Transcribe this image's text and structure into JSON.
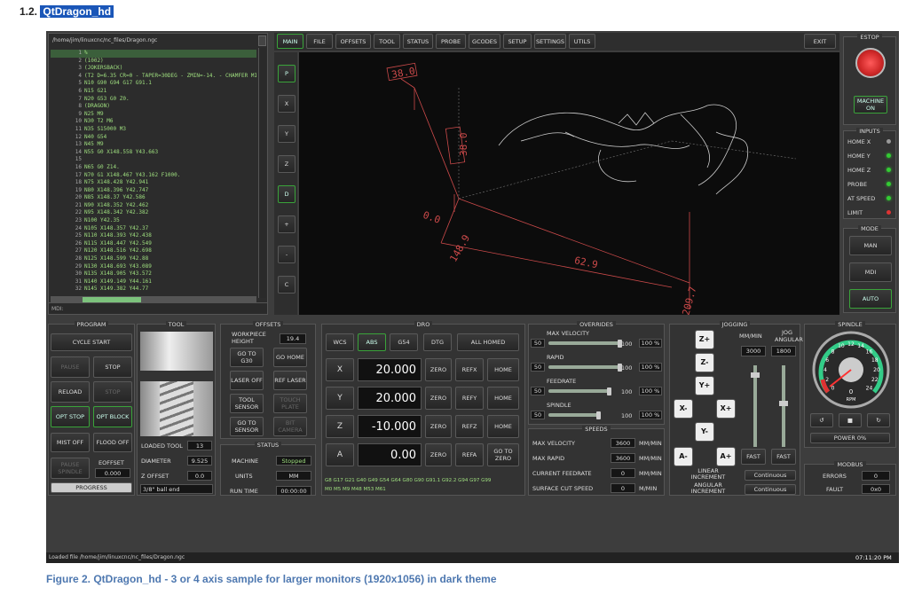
{
  "section": {
    "num": "1.2.",
    "title": "QtDragon_hd"
  },
  "caption": "Figure 2. QtDragon_hd - 3 or 4 axis sample for larger monitors (1920x1056) in dark theme",
  "file_path": "/home/jim/linuxcnc/nc_files/Dragon.ngc",
  "mdi_label": "MDI:",
  "gcode": [
    {
      "n": "1",
      "t": "%"
    },
    {
      "n": "2",
      "t": "(1002)"
    },
    {
      "n": "3",
      "t": "(JOKERSBACK)"
    },
    {
      "n": "4",
      "t": "(T2  D=6.35 CR=0 - TAPER=30DEG - ZMIN=-14. - CHAMFER MILL)"
    },
    {
      "n": "5",
      "t": "N10 G90 G94 G17 G91.1"
    },
    {
      "n": "6",
      "t": "N15 G21"
    },
    {
      "n": "7",
      "t": "N20 G53 G0 Z0."
    },
    {
      "n": "8",
      "t": "(DRAGON)"
    },
    {
      "n": "9",
      "t": "N25 M9"
    },
    {
      "n": "10",
      "t": "N30 T2 M6"
    },
    {
      "n": "11",
      "t": "N35 S15000 M3"
    },
    {
      "n": "12",
      "t": "N40 G54"
    },
    {
      "n": "13",
      "t": "N45 M9"
    },
    {
      "n": "14",
      "t": "N55 G0 X148.558 Y43.663"
    },
    {
      "n": "15",
      "t": ""
    },
    {
      "n": "16",
      "t": "N65 G0 Z14."
    },
    {
      "n": "17",
      "t": "N70 G1 X148.467 Y43.162 F1000."
    },
    {
      "n": "18",
      "t": "N75 X148.428 Y42.941"
    },
    {
      "n": "19",
      "t": "N80 X148.396 Y42.747"
    },
    {
      "n": "20",
      "t": "N85 X148.37 Y42.586"
    },
    {
      "n": "21",
      "t": "N90 X148.352 Y42.462"
    },
    {
      "n": "22",
      "t": "N95 X148.342 Y42.382"
    },
    {
      "n": "23",
      "t": "N100 Y42.35"
    },
    {
      "n": "24",
      "t": "N105 X148.357 Y42.37"
    },
    {
      "n": "25",
      "t": "N110 X148.393 Y42.438"
    },
    {
      "n": "26",
      "t": "N115 X148.447 Y42.549"
    },
    {
      "n": "27",
      "t": "N120 X148.516 Y42.698"
    },
    {
      "n": "28",
      "t": "N125 X148.599 Y42.88"
    },
    {
      "n": "29",
      "t": "N130 X148.693 Y43.089"
    },
    {
      "n": "30",
      "t": "N135 X148.905 Y43.572"
    },
    {
      "n": "31",
      "t": "N140 X149.149 Y44.161"
    },
    {
      "n": "32",
      "t": "N145 X149.382 Y44.77"
    }
  ],
  "tabs": [
    "MAIN",
    "FILE",
    "OFFSETS",
    "TOOL",
    "STATUS",
    "PROBE",
    "GCODES",
    "SETUP",
    "SETTINGS",
    "UTILS"
  ],
  "exit": "EXIT",
  "view_buttons": [
    "P",
    "X",
    "Y",
    "Z",
    "D",
    "+",
    "-",
    "C"
  ],
  "preview": {
    "l1": "38.0",
    "l2": "38.0",
    "l3": "0.0",
    "l4": "148.9",
    "l5": "62.9",
    "l6": "209.7"
  },
  "estop": {
    "title": "ESTOP",
    "machine_on": "MACHINE ON"
  },
  "inputs": {
    "title": "INPUTS",
    "items": [
      "HOME X",
      "HOME Y",
      "HOME Z",
      "PROBE",
      "AT SPEED",
      "LIMIT"
    ]
  },
  "mode": {
    "title": "MODE",
    "items": [
      "MAN",
      "MDI",
      "AUTO"
    ]
  },
  "program": {
    "title": "PROGRAM",
    "cycle_start": "CYCLE START",
    "pause": "PAUSE",
    "stop": "STOP",
    "reload": "RELOAD",
    "stop2": "STOP",
    "opt_stop": "OPT STOP",
    "opt_block": "OPT BLOCK",
    "mist": "MIST OFF",
    "flood": "FLOOD OFF",
    "pause_spindle": "PAUSE SPINDLE",
    "eoffset": "EOFFSET",
    "eoffset_val": "0.000",
    "progress": "PROGRESS"
  },
  "tool": {
    "title": "TOOL",
    "loaded_label": "LOADED TOOL",
    "loaded": "13",
    "diameter_label": "DIAMETER",
    "diameter": "9.525",
    "zoffset_label": "Z OFFSET",
    "zoffset": "0.0",
    "desc": "3/8\" ball end"
  },
  "offsets": {
    "title": "OFFSETS",
    "wp_label": "WORKPIECE HEIGHT",
    "wp": "19.4",
    "goto_g30": "GO TO G30",
    "go_home": "GO HOME",
    "laser_off": "LASER OFF",
    "ref_laser": "REF LASER",
    "tool_sensor": "TOOL SENSOR",
    "touch_plate": "TOUCH PLATE",
    "goto_sensor": "GO TO SENSOR",
    "bit_camera": "BIT CAMERA"
  },
  "status": {
    "title": "STATUS",
    "machine_label": "MACHINE",
    "machine": "Stopped",
    "units_label": "UNITS",
    "units": "MM",
    "runtime_label": "RUN TIME",
    "runtime": "00:00:00"
  },
  "dro": {
    "title": "DRO",
    "wcs": "WCS",
    "abs": "ABS",
    "g54": "G54",
    "dtg": "DTG",
    "all_homed": "ALL HOMED",
    "axes": [
      {
        "a": "X",
        "v": "20.000",
        "ref": "REFX",
        "home": "HOME"
      },
      {
        "a": "Y",
        "v": "20.000",
        "ref": "REFY",
        "home": "HOME"
      },
      {
        "a": "Z",
        "v": "-10.000",
        "ref": "REFZ",
        "home": "HOME"
      },
      {
        "a": "A",
        "v": "0.00",
        "ref": "REFA",
        "home": "GO TO ZERO"
      }
    ],
    "zero": "ZERO",
    "gcodes_line": "G8 G17 G21 G40 G49 G54 G64 G80 G90 G91.1 G92.2 G94 G97 G99",
    "mcodes_line": "M0 M5 M9 M48 M53 M61"
  },
  "overrides": {
    "title": "OVERRIDES",
    "items": [
      {
        "name": "MAX VELOCITY",
        "min": "50",
        "max": "100",
        "pct": "100 %",
        "level": 1.0
      },
      {
        "name": "RAPID",
        "min": "50",
        "max": "100",
        "pct": "100 %",
        "level": 1.0
      },
      {
        "name": "FEEDRATE",
        "min": "50",
        "max": "100",
        "pct": "100 %",
        "level": 0.85
      },
      {
        "name": "SPINDLE",
        "min": "50",
        "max": "100",
        "pct": "100 %",
        "level": 0.7
      }
    ]
  },
  "speeds": {
    "title": "SPEEDS",
    "items": [
      {
        "name": "MAX VELOCITY",
        "v": "3600",
        "u": "MM/MIN"
      },
      {
        "name": "MAX RAPID",
        "v": "3600",
        "u": "MM/MIN"
      },
      {
        "name": "CURRENT FEEDRATE",
        "v": "0",
        "u": "MM/MIN"
      },
      {
        "name": "SURFACE CUT SPEED",
        "v": "0",
        "u": "M/MIN"
      }
    ]
  },
  "jogging": {
    "title": "JOGGING",
    "mmmin": "MM/MIN",
    "jog_angular": "JOG ANGULAR",
    "lin": "3000",
    "ang": "1800",
    "zp": "Z+",
    "zm": "Z-",
    "yp": "Y+",
    "ym": "Y-",
    "xm": "X-",
    "xp": "X+",
    "am": "A-",
    "ap": "A+",
    "fast": "FAST",
    "fast2": "FAST",
    "lin_inc": "LINEAR INCREMENT",
    "ang_inc": "ANGULAR INCREMENT",
    "cont1": "Continuous",
    "cont2": "Continuous"
  },
  "spindle": {
    "title": "SPINDLE",
    "rpm": "0",
    "rpm_label": "RPM",
    "ticks": [
      "0",
      "2",
      "4",
      "6",
      "8",
      "10",
      "12",
      "14",
      "16",
      "18",
      "20",
      "22",
      "24"
    ],
    "power": "POWER 0%"
  },
  "modbus": {
    "title": "MODBUS",
    "errors_label": "ERRORS",
    "errors": "0",
    "fault_label": "FAULT",
    "fault": "0x0"
  },
  "statusbar": {
    "msg": "Loaded file /home/jim/linuxcnc/nc_files/Dragon.ngc",
    "time": "07:11:20 PM"
  }
}
